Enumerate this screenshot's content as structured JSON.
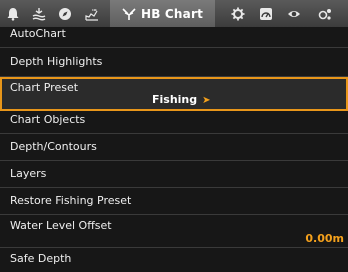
{
  "tabs": [
    {
      "icon": "alarm-bell-icon"
    },
    {
      "icon": "navigation-waves-icon"
    },
    {
      "icon": "compass-icon"
    },
    {
      "icon": "sonar-fish-icon"
    },
    {
      "icon": "hb-chart-icon",
      "label": "HB Chart",
      "active": true
    },
    {
      "icon": "gear-icon"
    },
    {
      "icon": "gauge-icon"
    },
    {
      "icon": "eye-icon"
    },
    {
      "icon": "network-icon"
    }
  ],
  "menu": {
    "items": [
      {
        "label": "AutoChart"
      },
      {
        "label": "Depth Highlights"
      },
      {
        "label": "Chart Preset",
        "value": "Fishing"
      },
      {
        "label": "Chart Objects"
      },
      {
        "label": "Depth/Contours"
      },
      {
        "label": "Layers"
      },
      {
        "label": "Restore Fishing Preset"
      },
      {
        "label": "Water Level Offset",
        "value": "0.00m"
      },
      {
        "label": "Safe Depth"
      }
    ]
  },
  "colors": {
    "accent": "#e8961a",
    "value_text": "#f5a11c",
    "tabbar": "#4a4a4a"
  }
}
